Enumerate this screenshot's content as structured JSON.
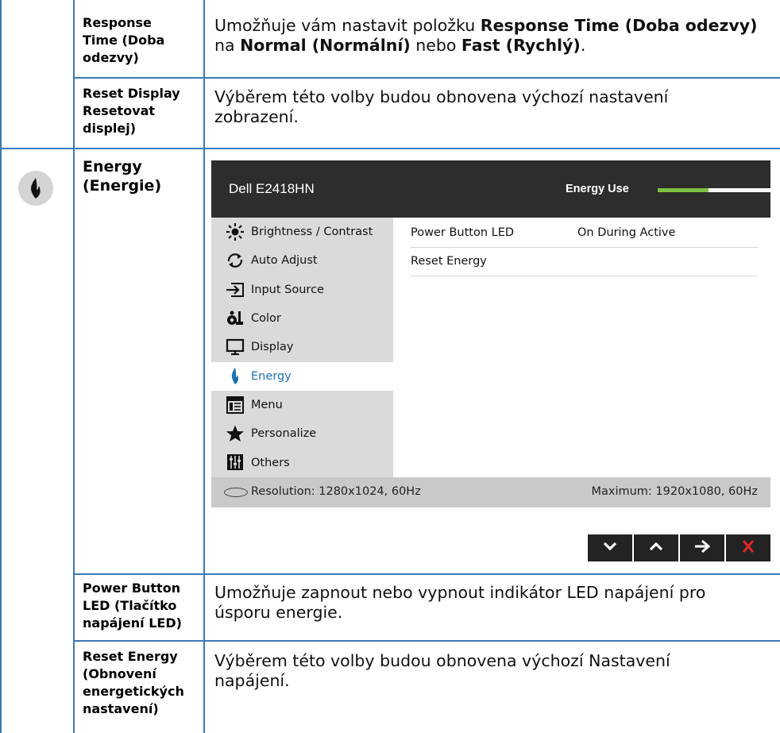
{
  "rows": {
    "response_time": {
      "label": [
        "Response",
        "Time (Doba",
        "odezvy)"
      ],
      "desc_parts": [
        {
          "t": "Umožňuje vám nastavit položku ",
          "b": false
        },
        {
          "t": "Response Time (Doba odezvy)",
          "b": true
        },
        {
          "t": "\n",
          "b": false
        },
        {
          "t": "na ",
          "b": false
        },
        {
          "t": "Normal (Normální)",
          "b": true
        },
        {
          "t": " nebo ",
          "b": false
        },
        {
          "t": "Fast (Rychlý)",
          "b": true
        },
        {
          "t": ".",
          "b": false
        }
      ]
    },
    "reset_display": {
      "label": [
        "Reset Display",
        "Resetovat",
        "displej)"
      ],
      "desc": [
        "Výběrem této volby budou obnovena výchozí nastavení",
        "zobrazení."
      ]
    },
    "energy": {
      "label": [
        "Energy",
        "(Energie)"
      ]
    },
    "power_button_led": {
      "label": [
        "Power Button",
        "LED (Tlačítko",
        "napájení LED)"
      ],
      "desc": [
        "Umožňuje zapnout nebo vypnout indikátor LED napájení pro",
        "úsporu energie."
      ]
    },
    "reset_energy": {
      "label": [
        "Reset Energy",
        "(Obnovení",
        "energetických",
        "nastavení)"
      ],
      "desc": [
        "Výběrem této volby budou obnovena výchozí Nastavení",
        "napájení."
      ]
    }
  },
  "osd": {
    "title": "Dell E2418HN",
    "energy_use_label": "Energy Use",
    "energy_use_level": 0.45,
    "menu": [
      {
        "label": "Brightness / Contrast",
        "icon": "brightness-icon"
      },
      {
        "label": "Auto Adjust",
        "icon": "auto-adjust-icon"
      },
      {
        "label": "Input Source",
        "icon": "input-source-icon"
      },
      {
        "label": "Color",
        "icon": "color-icon"
      },
      {
        "label": "Display",
        "icon": "display-icon"
      },
      {
        "label": "Energy",
        "icon": "energy-icon",
        "active": true
      },
      {
        "label": "Menu",
        "icon": "menu-icon"
      },
      {
        "label": "Personalize",
        "icon": "star-icon"
      },
      {
        "label": "Others",
        "icon": "others-icon"
      }
    ],
    "options": [
      {
        "key": "Power Button LED",
        "value": "On During Active"
      },
      {
        "key": "Reset Energy",
        "value": ""
      }
    ],
    "resolution": "Resolution: 1280x1024, 60Hz",
    "maximum": "Maximum: 1920x1080, 60Hz"
  },
  "nav_buttons": [
    "down-arrow-icon",
    "up-arrow-icon",
    "right-arrow-icon",
    "close-icon"
  ],
  "colors": {
    "table_lines": "#3a79b8",
    "energy_accent": "#1d6fb3",
    "energy_bar": "#7ec242",
    "close_red": "#e0262a"
  }
}
